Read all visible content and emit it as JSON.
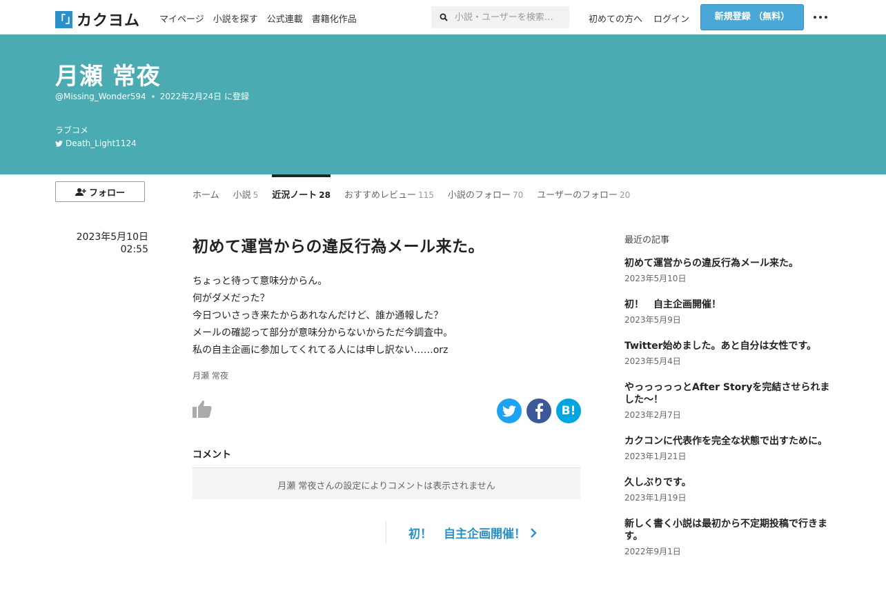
{
  "header": {
    "logo_mark": "「」",
    "logo_text": "カクヨム",
    "nav": [
      "マイページ",
      "小説を探す",
      "公式連載",
      "書籍化作品"
    ],
    "search_placeholder": "小説・ユーザーを検索…",
    "beginner_link": "初めての方へ",
    "login_link": "ログイン",
    "signup_button": "新規登録 （無料）"
  },
  "profile": {
    "name": "月瀬 常夜",
    "handle": "@Missing_Wonder594",
    "registered": "2022年2月24日 に登録",
    "bio": "ラブコメ",
    "twitter": "Death_Light1124",
    "follow_button": "フォロー"
  },
  "tabs": [
    {
      "label": "ホーム",
      "count": ""
    },
    {
      "label": "小説",
      "count": "5"
    },
    {
      "label": "近況ノート",
      "count": "28"
    },
    {
      "label": "おすすめレビュー",
      "count": "115"
    },
    {
      "label": "小説のフォロー",
      "count": "70"
    },
    {
      "label": "ユーザーのフォロー",
      "count": "20"
    }
  ],
  "post": {
    "date": "2023年5月10日",
    "time": "02:55",
    "title": "初めて運営からの違反行為メール来た。",
    "lines": [
      "ちょっと待って意味分からん。",
      "何がダメだった？",
      "今日ついさっき来たからあれなんだけど、誰か通報した？",
      "メールの確認って部分が意味分からないからただ今調査中。",
      "私の自主企画に参加してくれてる人には申し訳ない……orz"
    ],
    "author": "月瀬 常夜",
    "comment_title": "コメント",
    "comment_notice": "月瀬 常夜さんの設定によりコメントは表示されません",
    "next_link": "初！　自主企画開催！"
  },
  "sidebar": {
    "heading": "最近の記事",
    "items": [
      {
        "title": "初めて運営からの違反行為メール来た。",
        "date": "2023年5月10日"
      },
      {
        "title": "初！　自主企画開催！",
        "date": "2023年5月9日"
      },
      {
        "title": "Twitter始めました。あと自分は女性です。",
        "date": "2023年5月4日"
      },
      {
        "title": "やっっっっっとAfter Storyを完結させられました～！",
        "date": "2023年2月7日"
      },
      {
        "title": "カクコンに代表作を完全な状態で出すために。",
        "date": "2023年1月21日"
      },
      {
        "title": "久しぶりです。",
        "date": "2023年1月19日"
      },
      {
        "title": "新しく書く小説は最初から不定期投稿で行きます。",
        "date": "2022年9月1日"
      }
    ]
  },
  "share": {
    "hatena_label": "B!"
  },
  "colors": {
    "hero": "#4aabb3",
    "signup": "#4aa8d8",
    "twitter": "#1da1f2",
    "facebook": "#3b5998",
    "hatena": "#00a4de",
    "link": "#2a90c7"
  }
}
